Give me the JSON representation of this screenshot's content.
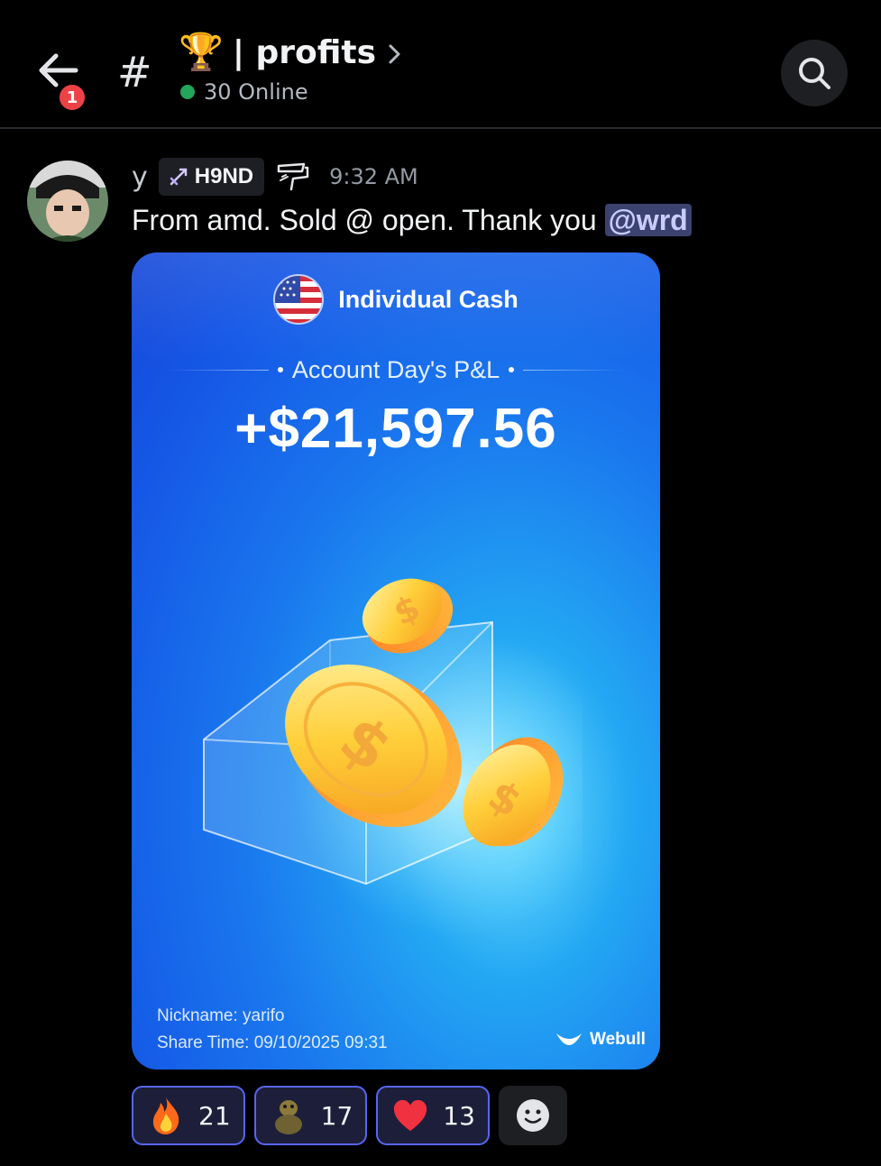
{
  "header": {
    "unread_badge": "1",
    "channel_icon": "hash-icon",
    "channel_emoji": "🏆",
    "channel_name": "| profits",
    "online_count": "30 Online",
    "online_color": "#23a55a"
  },
  "message": {
    "username": "y",
    "guild_tag": "H9ND",
    "timestamp": "9:32 AM",
    "text": "From amd. Sold @ open. Thank you ",
    "mention": "@wrd"
  },
  "card": {
    "account_name": "Individual Cash",
    "pnl_label": "Account Day's P&L",
    "pnl_value": "+$21,597.56",
    "nickname": "Nickname: yarifo",
    "share_time": "Share Time: 09/10/2025 09:31",
    "brand": "Webull"
  },
  "reactions": [
    {
      "emoji": "fire-icon",
      "count": "21"
    },
    {
      "emoji": "frog-icon",
      "count": "17"
    },
    {
      "emoji": "heart-icon",
      "count": "13"
    }
  ],
  "colors": {
    "background": "#000000",
    "accent": "#5865f2",
    "badge": "#ed4245",
    "card_blue": "#1a78ee"
  }
}
